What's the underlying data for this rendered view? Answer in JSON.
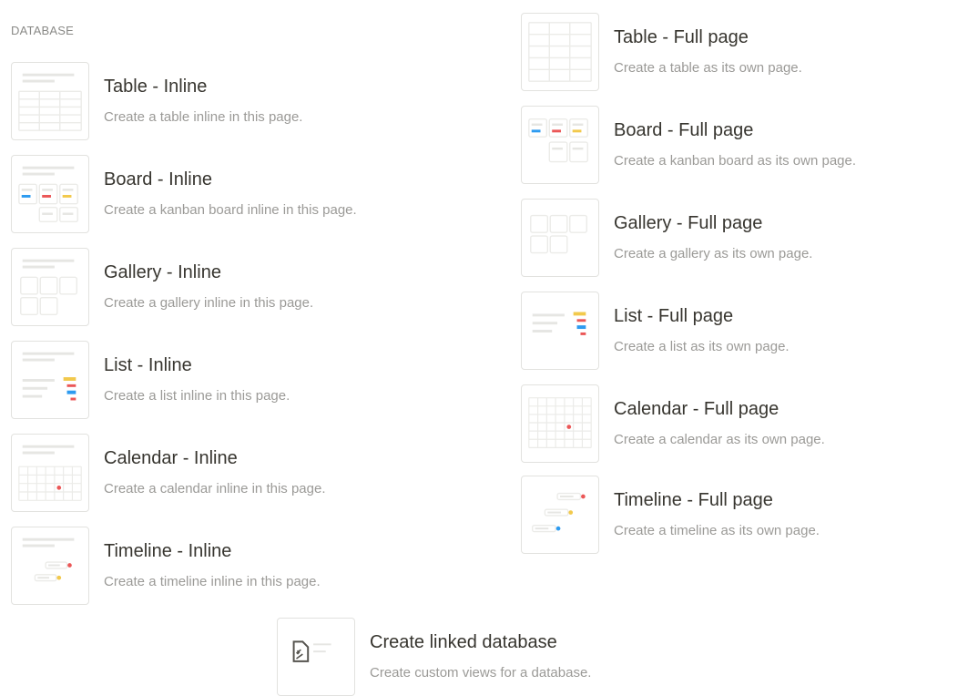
{
  "section": {
    "label": "DATABASE"
  },
  "inline": [
    {
      "key": "table",
      "icon": "table-icon",
      "title": "Table - Inline",
      "desc": "Create a table inline in this page."
    },
    {
      "key": "board",
      "icon": "board-icon",
      "title": "Board - Inline",
      "desc": "Create a kanban board inline in this page."
    },
    {
      "key": "gallery",
      "icon": "gallery-icon",
      "title": "Gallery - Inline",
      "desc": "Create a gallery inline in this page."
    },
    {
      "key": "list",
      "icon": "list-icon",
      "title": "List - Inline",
      "desc": "Create a list inline in this page."
    },
    {
      "key": "calendar",
      "icon": "calendar-icon",
      "title": "Calendar - Inline",
      "desc": "Create a calendar inline in this page."
    },
    {
      "key": "timeline",
      "icon": "timeline-icon",
      "title": "Timeline - Inline",
      "desc": "Create a timeline inline in this page."
    }
  ],
  "full": [
    {
      "key": "table",
      "icon": "table-icon",
      "title": "Table - Full page",
      "desc": "Create a table as its own page."
    },
    {
      "key": "board",
      "icon": "board-icon",
      "title": "Board - Full page",
      "desc": "Create a kanban board as its own page."
    },
    {
      "key": "gallery",
      "icon": "gallery-icon",
      "title": "Gallery - Full page",
      "desc": "Create a gallery as its own page."
    },
    {
      "key": "list",
      "icon": "list-icon",
      "title": "List - Full page",
      "desc": "Create a list as its own page."
    },
    {
      "key": "calendar",
      "icon": "calendar-icon",
      "title": "Calendar - Full page",
      "desc": "Create a calendar as its own page."
    },
    {
      "key": "timeline",
      "icon": "timeline-icon",
      "title": "Timeline - Full page",
      "desc": "Create a timeline as its own page."
    }
  ],
  "linked": {
    "icon": "linked-database-icon",
    "title": "Create linked database",
    "desc": "Create custom views for a database."
  },
  "colors": {
    "blue": "#2d9bf0",
    "red": "#eb5757",
    "yellow": "#f2c94c",
    "line": "#e6e6e3",
    "grid": "#ebebe8"
  }
}
